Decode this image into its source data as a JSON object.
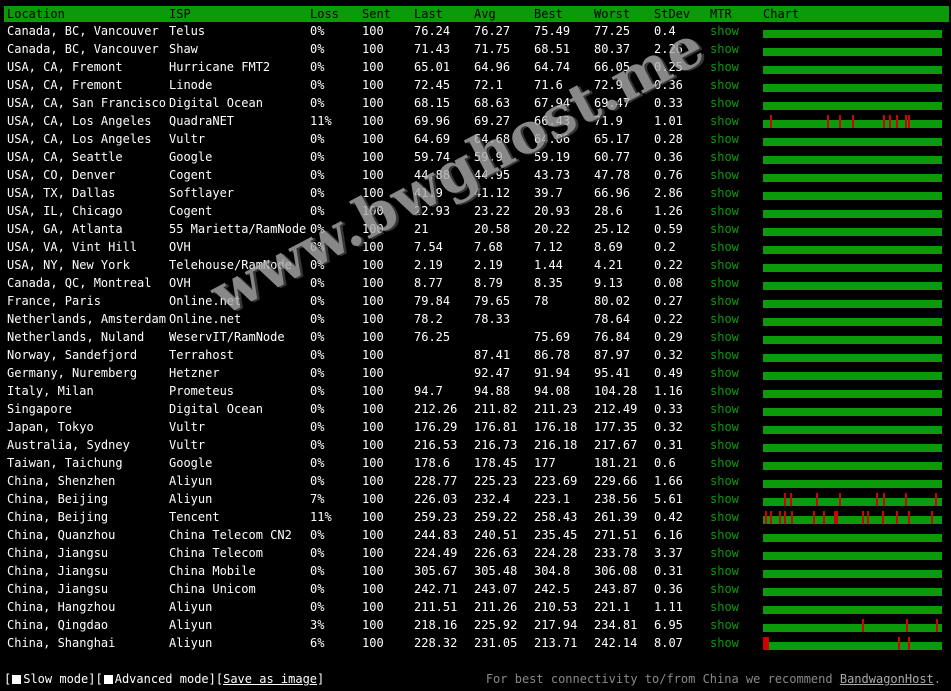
{
  "headers": {
    "location": "Location",
    "isp": "ISP",
    "loss": "Loss",
    "sent": "Sent",
    "last": "Last",
    "avg": "Avg",
    "best": "Best",
    "worst": "Worst",
    "stdev": "StDev",
    "mtr": "MTR",
    "chart": "Chart"
  },
  "mtr_link": "show",
  "rows": [
    {
      "location": "Canada, BC, Vancouver",
      "isp": "Telus",
      "loss": "0%",
      "sent": "100",
      "last": "76.24",
      "avg": "76.27",
      "best": "75.49",
      "worst": "77.25",
      "stdev": "0.4",
      "spikes": []
    },
    {
      "location": "Canada, BC, Vancouver",
      "isp": "Shaw",
      "loss": "0%",
      "sent": "100",
      "last": "71.43",
      "avg": "71.75",
      "best": "68.51",
      "worst": "80.37",
      "stdev": "2.26",
      "spikes": []
    },
    {
      "location": "USA, CA, Fremont",
      "isp": "Hurricane FMT2",
      "loss": "0%",
      "sent": "100",
      "last": "65.01",
      "avg": "64.96",
      "best": "64.74",
      "worst": "66.05",
      "stdev": "0.25",
      "spikes": []
    },
    {
      "location": "USA, CA, Fremont",
      "isp": "Linode",
      "loss": "0%",
      "sent": "100",
      "last": "72.45",
      "avg": "72.1",
      "best": "71.6",
      "worst": "72.9",
      "stdev": "0.36",
      "spikes": []
    },
    {
      "location": "USA, CA, San Francisco",
      "isp": "Digital Ocean",
      "loss": "0%",
      "sent": "100",
      "last": "68.15",
      "avg": "68.63",
      "best": "67.94",
      "worst": "69.47",
      "stdev": "0.33",
      "spikes": []
    },
    {
      "location": "USA, CA, Los Angeles",
      "isp": "QuadraNET",
      "loss": "11%",
      "sent": "100",
      "last": "69.96",
      "avg": "69.27",
      "best": "66.43",
      "worst": "71.9",
      "stdev": "1.01",
      "spikes": [
        4,
        36,
        43,
        50,
        68,
        71,
        75,
        80,
        82
      ]
    },
    {
      "location": "USA, CA, Los Angeles",
      "isp": "Vultr",
      "loss": "0%",
      "sent": "100",
      "last": "64.69",
      "avg": "64.68",
      "best": "64.06",
      "worst": "65.17",
      "stdev": "0.28",
      "spikes": []
    },
    {
      "location": "USA, CA, Seattle",
      "isp": "Google",
      "loss": "0%",
      "sent": "100",
      "last": "59.74",
      "avg": "59.9",
      "best": "59.19",
      "worst": "60.77",
      "stdev": "0.36",
      "spikes": []
    },
    {
      "location": "USA, CO, Denver",
      "isp": "Cogent",
      "loss": "0%",
      "sent": "100",
      "last": "44.88",
      "avg": "44.95",
      "best": "43.73",
      "worst": "47.78",
      "stdev": "0.76",
      "spikes": []
    },
    {
      "location": "USA, TX, Dallas",
      "isp": "Softlayer",
      "loss": "0%",
      "sent": "100",
      "last": "41.9",
      "avg": "41.12",
      "best": "39.7",
      "worst": "66.96",
      "stdev": "2.86",
      "spikes": []
    },
    {
      "location": "USA, IL, Chicago",
      "isp": "Cogent",
      "loss": "0%",
      "sent": "100",
      "last": "22.93",
      "avg": "23.22",
      "best": "20.93",
      "worst": "28.6",
      "stdev": "1.26",
      "spikes": []
    },
    {
      "location": "USA, GA, Atlanta",
      "isp": "55 Marietta/RamNode",
      "loss": "0%",
      "sent": "100",
      "last": "21",
      "avg": "20.58",
      "best": "20.22",
      "worst": "25.12",
      "stdev": "0.59",
      "spikes": []
    },
    {
      "location": "USA, VA, Vint Hill",
      "isp": "OVH",
      "loss": "0%",
      "sent": "100",
      "last": "7.54",
      "avg": "7.68",
      "best": "7.12",
      "worst": "8.69",
      "stdev": "0.2",
      "spikes": []
    },
    {
      "location": "USA, NY, New York",
      "isp": "Telehouse/RamNode",
      "loss": "0%",
      "sent": "100",
      "last": "2.19",
      "avg": "2.19",
      "best": "1.44",
      "worst": "4.21",
      "stdev": "0.22",
      "spikes": []
    },
    {
      "location": "Canada, QC, Montreal",
      "isp": "OVH",
      "loss": "0%",
      "sent": "100",
      "last": "8.77",
      "avg": "8.79",
      "best": "8.35",
      "worst": "9.13",
      "stdev": "0.08",
      "spikes": []
    },
    {
      "location": "France, Paris",
      "isp": "Online.net",
      "loss": "0%",
      "sent": "100",
      "last": "79.84",
      "avg": "79.65",
      "best": "78",
      "worst": "80.02",
      "stdev": "0.27",
      "spikes": []
    },
    {
      "location": "Netherlands, Amsterdam",
      "isp": "Online.net",
      "loss": "0%",
      "sent": "100",
      "last": "78.2",
      "avg": "78.33",
      "best": "",
      "worst": "78.64",
      "stdev": "0.22",
      "spikes": []
    },
    {
      "location": "Netherlands, Nuland",
      "isp": "WeservIT/RamNode",
      "loss": "0%",
      "sent": "100",
      "last": "76.25",
      "avg": "",
      "best": "75.69",
      "worst": "76.84",
      "stdev": "0.29",
      "spikes": []
    },
    {
      "location": "Norway, Sandefjord",
      "isp": "Terrahost",
      "loss": "0%",
      "sent": "100",
      "last": "",
      "avg": "87.41",
      "best": "86.78",
      "worst": "87.97",
      "stdev": "0.32",
      "spikes": []
    },
    {
      "location": "Germany, Nuremberg",
      "isp": "Hetzner",
      "loss": "0%",
      "sent": "100",
      "last": "",
      "avg": "92.47",
      "best": "91.94",
      "worst": "95.41",
      "stdev": "0.49",
      "spikes": []
    },
    {
      "location": "Italy, Milan",
      "isp": "Prometeus",
      "loss": "0%",
      "sent": "100",
      "last": "94.7",
      "avg": "94.88",
      "best": "94.08",
      "worst": "104.28",
      "stdev": "1.16",
      "spikes": []
    },
    {
      "location": "Singapore",
      "isp": "Digital Ocean",
      "loss": "0%",
      "sent": "100",
      "last": "212.26",
      "avg": "211.82",
      "best": "211.23",
      "worst": "212.49",
      "stdev": "0.33",
      "spikes": []
    },
    {
      "location": "Japan, Tokyo",
      "isp": "Vultr",
      "loss": "0%",
      "sent": "100",
      "last": "176.29",
      "avg": "176.81",
      "best": "176.18",
      "worst": "177.35",
      "stdev": "0.32",
      "spikes": []
    },
    {
      "location": "Australia, Sydney",
      "isp": "Vultr",
      "loss": "0%",
      "sent": "100",
      "last": "216.53",
      "avg": "216.73",
      "best": "216.18",
      "worst": "217.67",
      "stdev": "0.31",
      "spikes": []
    },
    {
      "location": "Taiwan, Taichung",
      "isp": "Google",
      "loss": "0%",
      "sent": "100",
      "last": "178.6",
      "avg": "178.45",
      "best": "177",
      "worst": "181.21",
      "stdev": "0.6",
      "spikes": []
    },
    {
      "location": "China, Shenzhen",
      "isp": "Aliyun",
      "loss": "0%",
      "sent": "100",
      "last": "228.77",
      "avg": "225.23",
      "best": "223.69",
      "worst": "229.66",
      "stdev": "1.66",
      "spikes": []
    },
    {
      "location": "China, Beijing",
      "isp": "Aliyun",
      "loss": "7%",
      "sent": "100",
      "last": "226.03",
      "avg": "232.4",
      "best": "223.1",
      "worst": "238.56",
      "stdev": "5.61",
      "spikes": [
        12,
        15,
        30,
        43,
        64,
        68,
        80,
        97
      ]
    },
    {
      "location": "China, Beijing",
      "isp": "Tencent",
      "loss": "11%",
      "sent": "100",
      "last": "259.23",
      "avg": "259.22",
      "best": "258.43",
      "worst": "261.39",
      "stdev": "0.42",
      "spikes": [
        1,
        4,
        9,
        12,
        16,
        28,
        34,
        40,
        41,
        56,
        59,
        67,
        75,
        82,
        95
      ]
    },
    {
      "location": "China, Quanzhou",
      "isp": "China Telecom CN2",
      "loss": "0%",
      "sent": "100",
      "last": "244.83",
      "avg": "240.51",
      "best": "235.45",
      "worst": "271.51",
      "stdev": "6.16",
      "spikes": []
    },
    {
      "location": "China, Jiangsu",
      "isp": "China Telecom",
      "loss": "0%",
      "sent": "100",
      "last": "224.49",
      "avg": "226.63",
      "best": "224.28",
      "worst": "233.78",
      "stdev": "3.37",
      "spikes": []
    },
    {
      "location": "China, Jiangsu",
      "isp": "China Mobile",
      "loss": "0%",
      "sent": "100",
      "last": "305.67",
      "avg": "305.48",
      "best": "304.8",
      "worst": "306.08",
      "stdev": "0.31",
      "spikes": []
    },
    {
      "location": "China, Jiangsu",
      "isp": "China Unicom",
      "loss": "0%",
      "sent": "100",
      "last": "242.71",
      "avg": "243.07",
      "best": "242.5",
      "worst": "243.87",
      "stdev": "0.36",
      "spikes": []
    },
    {
      "location": "China, Hangzhou",
      "isp": "Aliyun",
      "loss": "0%",
      "sent": "100",
      "last": "211.51",
      "avg": "211.26",
      "best": "210.53",
      "worst": "221.1",
      "stdev": "1.11",
      "spikes": []
    },
    {
      "location": "China, Qingdao",
      "isp": "Aliyun",
      "loss": "3%",
      "sent": "100",
      "last": "218.16",
      "avg": "225.92",
      "best": "217.94",
      "worst": "234.81",
      "stdev": "6.95",
      "spikes": [
        56,
        81,
        98
      ]
    },
    {
      "location": "China, Shanghai",
      "isp": "Aliyun",
      "loss": "6%",
      "sent": "100",
      "last": "228.32",
      "avg": "231.05",
      "best": "213.71",
      "worst": "242.14",
      "stdev": "8.07",
      "spikes": [
        0,
        1,
        2,
        76,
        82
      ]
    }
  ],
  "watermark": "www.bwghost.me",
  "footer": {
    "slow_mode": "Slow mode",
    "advanced_mode": "Advanced mode",
    "save_image": "Save as image",
    "recommend_text": "For best connectivity to/from China we recommend",
    "recommend_link": "BandwagonHost",
    "recommend_suffix": "."
  },
  "colors": {
    "green": "#0a9a0a",
    "red": "#d40000",
    "background": "#000000"
  }
}
